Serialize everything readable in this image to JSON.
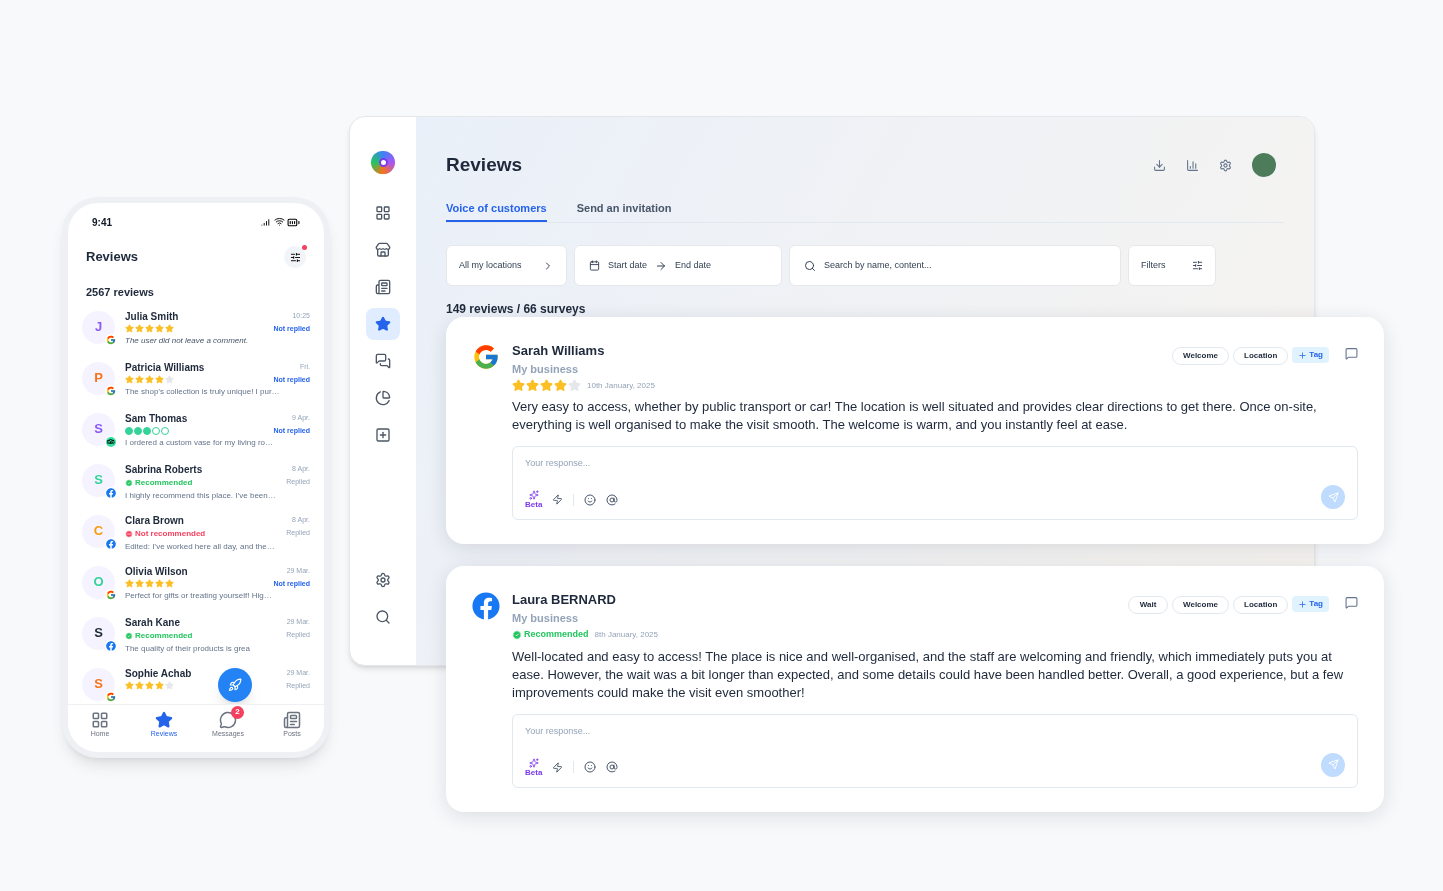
{
  "phone": {
    "time": "9:41",
    "title": "Reviews",
    "filter_badge": true,
    "count": "2567 reviews",
    "items": [
      {
        "initial": "J",
        "color": "#8b5cf6",
        "source": {
          "kind": "google"
        },
        "name": "Julia Smith",
        "time": "10:25",
        "rating": {
          "kind": "stars",
          "stars": 5
        },
        "status": "Not replied",
        "replied": false,
        "excerpt": "The user did not leave a comment.",
        "italic": true
      },
      {
        "initial": "P",
        "color": "#f97316",
        "source": {
          "kind": "google"
        },
        "name": "Patricia Williams",
        "time": "Fri.",
        "rating": {
          "kind": "stars",
          "stars": 4
        },
        "status": "Not replied",
        "replied": false,
        "excerpt": "The shop’s collection is truly unique! I pur…"
      },
      {
        "initial": "S",
        "color": "#8b5cf6",
        "source": {
          "kind": "tripadvisor"
        },
        "name": "Sam Thomas",
        "time": "9 Apr.",
        "rating": {
          "kind": "dots",
          "stars": 3
        },
        "status": "Not replied",
        "replied": false,
        "excerpt": "I ordered a custom vase for my living ro…"
      },
      {
        "initial": "S",
        "color": "#34d399",
        "source": {
          "kind": "facebook"
        },
        "name": "Sabrina Roberts",
        "time": "8 Apr.",
        "rating": {
          "kind": "recommended",
          "text": "Recommended"
        },
        "status": "Replied",
        "replied": true,
        "excerpt": "I highly recommend this place. I’ve been…"
      },
      {
        "initial": "C",
        "color": "#f59e0b",
        "source": {
          "kind": "facebook"
        },
        "name": "Clara Brown",
        "time": "8 Apr.",
        "rating": {
          "kind": "not_recommended",
          "text": "Not recommended"
        },
        "status": "Replied",
        "replied": true,
        "excerpt": "Edited: I’ve worked here all day, and the…"
      },
      {
        "initial": "O",
        "color": "#34d399",
        "source": {
          "kind": "google"
        },
        "name": "Olivia Wilson",
        "time": "29 Mar.",
        "rating": {
          "kind": "stars",
          "stars": 5
        },
        "status": "Not replied",
        "replied": false,
        "excerpt": "Perfect for gifts or treating yourself! Hig…"
      },
      {
        "initial": "S",
        "color": "#1f2937",
        "source": {
          "kind": "facebook"
        },
        "name": "Sarah Kane",
        "time": "29 Mar.",
        "rating": {
          "kind": "recommended",
          "text": "Recommended"
        },
        "status": "Replied",
        "replied": true,
        "excerpt": "The quality of their products is grea"
      },
      {
        "initial": "S",
        "color": "#f97316",
        "source": {
          "kind": "google"
        },
        "name": "Sophie Achab",
        "time": "29 Mar.",
        "rating": {
          "kind": "stars",
          "stars": 4
        },
        "status": "Replied",
        "replied": true
      }
    ],
    "nav": [
      {
        "kind": "home",
        "label": "Home",
        "selected": false
      },
      {
        "kind": "reviews",
        "label": "Reviews",
        "selected": true
      },
      {
        "kind": "messages",
        "label": "Messages",
        "selected": false,
        "badge": "2"
      },
      {
        "kind": "posts",
        "label": "Posts",
        "selected": false
      }
    ]
  },
  "desktop": {
    "sidebar": [
      {
        "kind": "grid",
        "selected": false
      },
      {
        "kind": "store",
        "selected": false
      },
      {
        "kind": "news",
        "selected": false
      },
      {
        "kind": "reviews",
        "selected": true
      },
      {
        "kind": "chat",
        "selected": false
      },
      {
        "kind": "pie",
        "selected": false
      },
      {
        "kind": "apps",
        "selected": false
      },
      {
        "kind": "settings",
        "selected": false
      },
      {
        "kind": "search",
        "selected": false
      }
    ],
    "title": "Reviews",
    "tabs": [
      {
        "label": "Voice of customers",
        "selected": true
      },
      {
        "label": "Send an invitation",
        "selected": false
      }
    ],
    "filters": {
      "locations": "All my locations",
      "start_date": "Start date",
      "end_date": "End date",
      "search_placeholder": "Search by name, content...",
      "filters": "Filters"
    },
    "summary": "149 reviews / 66 surveys",
    "reviews": [
      {
        "source": {
          "kind": "google"
        },
        "name": "Sarah Williams",
        "business": "My business",
        "rating": {
          "kind": "stars",
          "stars": 4
        },
        "date": "10th January, 2025",
        "text": "Very easy to access, whether by public transport or car! The location is well situated and provides clear directions to get there. Once on-site, everything is well organised to make the visit smooth. The welcome is warm, and you instantly feel at ease.",
        "tags": [
          "Welcome",
          "Location"
        ],
        "add_tag": "Tag",
        "response_placeholder": "Your response...",
        "beta": "Beta"
      },
      {
        "source": {
          "kind": "facebook"
        },
        "name": "Laura BERNARD",
        "business": "My business",
        "rating": {
          "kind": "recommended",
          "text": "Recommended"
        },
        "date": "8th January, 2025",
        "text": "Well-located and easy to access! The place is nice and well-organised, and the staff are welcoming and friendly, which immediately puts you at ease. However, the wait was a bit longer than expected, and some details could have been handled better. Overall, a good experience, but a few improvements could make the visit even smoother!",
        "tags": [
          "Wait",
          "Welcome",
          "Location"
        ],
        "add_tag": "Tag",
        "response_placeholder": "Your response...",
        "beta": "Beta"
      }
    ]
  }
}
